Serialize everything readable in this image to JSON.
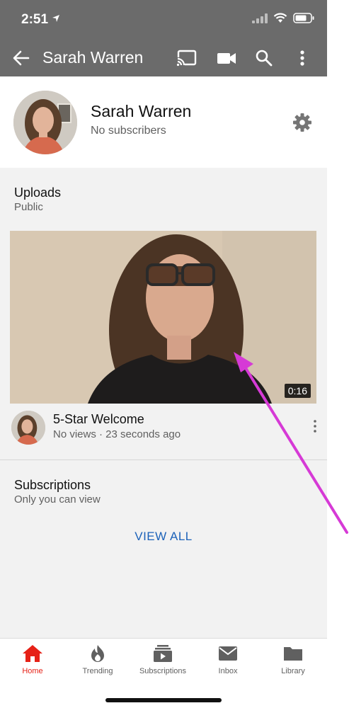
{
  "status_bar": {
    "time": "2:51"
  },
  "app_bar": {
    "title": "Sarah Warren"
  },
  "channel": {
    "name": "Sarah Warren",
    "subscribers": "No subscribers"
  },
  "uploads": {
    "title": "Uploads",
    "visibility": "Public",
    "video": {
      "title": "5-Star Welcome",
      "meta": "No views · 23 seconds ago",
      "duration": "0:16"
    }
  },
  "subscriptions": {
    "title": "Subscriptions",
    "visibility": "Only you can view",
    "view_all": "VIEW ALL"
  },
  "bottom_nav": [
    {
      "label": "Home",
      "icon": "home-icon",
      "active": true
    },
    {
      "label": "Trending",
      "icon": "flame-icon",
      "active": false
    },
    {
      "label": "Subscriptions",
      "icon": "subscriptions-icon",
      "active": false
    },
    {
      "label": "Inbox",
      "icon": "inbox-icon",
      "active": false
    },
    {
      "label": "Library",
      "icon": "folder-icon",
      "active": false
    }
  ],
  "colors": {
    "accent": "#e62117",
    "link": "#1c62b9",
    "app_bar": "#6b6b6b",
    "annotation_arrow": "#d63ad6"
  }
}
